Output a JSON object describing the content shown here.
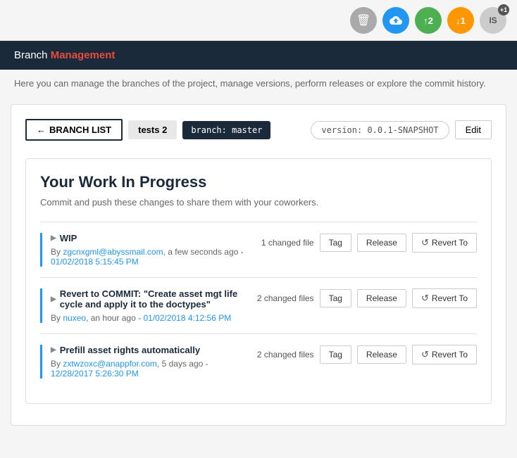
{
  "toolbar": {
    "trash_label": "🗑",
    "upload_label": "☁",
    "up_count": "↑2",
    "down_count": "↓1",
    "user_initials": "IS",
    "user_badge": "+1"
  },
  "header": {
    "title": "Branch Management",
    "title_highlight": "Management"
  },
  "description": "Here you can manage the branches of the project, manage versions, perform releases or explore the commit history.",
  "nav": {
    "branch_list_label": "BRANCH LIST",
    "branch_display_name": "tests 2",
    "branch_code": "branch: master",
    "version_label": "version: 0.0.1-SNAPSHOT",
    "edit_label": "Edit"
  },
  "wip": {
    "title": "Your Work In Progress",
    "subtitle": "Commit and push these changes to share them with your coworkers."
  },
  "commits": [
    {
      "id": "wip",
      "title": "WIP",
      "meta_prefix": "By",
      "author": "zgcnxgml@abyssmail.com",
      "time": "a few seconds ago",
      "separator": " - ",
      "date": "01/02/2018 5:15:45 PM",
      "changed_files": "1 changed file",
      "tag_label": "Tag",
      "release_label": "Release",
      "revert_label": "Revert To"
    },
    {
      "id": "revert-commit",
      "title": "Revert to COMMIT: \"Create asset mgt life cycle and apply it to the doctypes\"",
      "meta_prefix": "By",
      "author": "nuxeo",
      "time": "an hour ago",
      "separator": " - ",
      "date": "01/02/2018 4:12:56 PM",
      "changed_files": "2 changed files",
      "tag_label": "Tag",
      "release_label": "Release",
      "revert_label": "Revert To"
    },
    {
      "id": "prefill-commit",
      "title": "Prefill asset rights automatically",
      "meta_prefix": "By",
      "author": "zxtwzoxc@anappfor.com",
      "time": "5 days ago",
      "separator": " - ",
      "date": "12/28/2017 5:26:30 PM",
      "changed_files": "2 changed files",
      "tag_label": "Tag",
      "release_label": "Release",
      "revert_label": "Revert To"
    }
  ]
}
